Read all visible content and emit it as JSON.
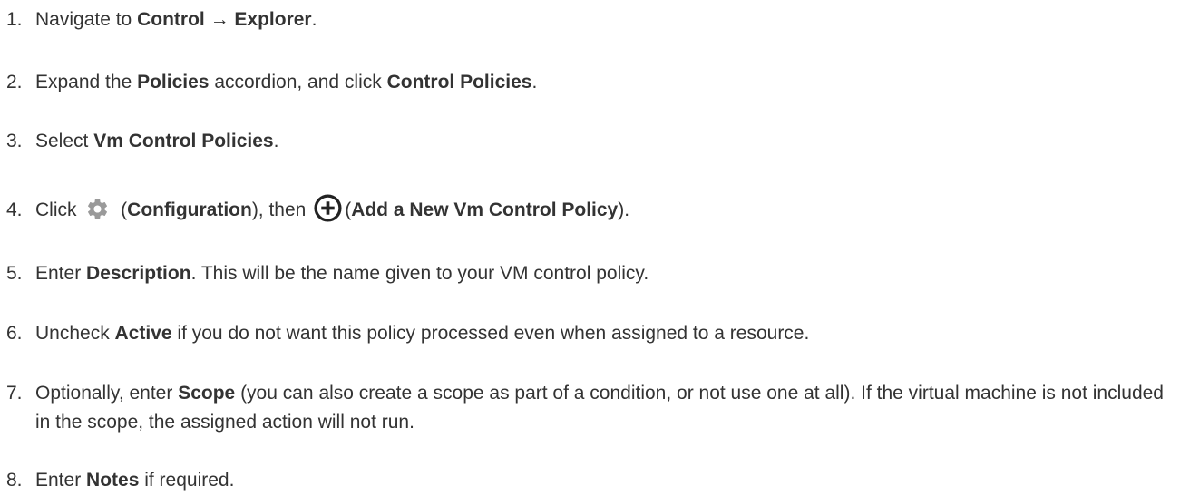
{
  "steps": [
    {
      "num": "1.",
      "t0": "Navigate to ",
      "b0": "Control",
      "t1": " → ",
      "b1": "Explorer",
      "t2": "."
    },
    {
      "num": "2.",
      "t0": "Expand the ",
      "b0": "Policies",
      "t1": " accordion, and click ",
      "b1": "Control Policies",
      "t2": "."
    },
    {
      "num": "3.",
      "t0": "Select ",
      "b0": "Vm Control Policies",
      "t1": "."
    },
    {
      "num": "4.",
      "t0": "Click ",
      "t1": " (",
      "b0": "Configuration",
      "t2": "), then ",
      "t3": "(",
      "b1": "Add a New Vm Control Policy",
      "t4": ").",
      "icon1": "gear-icon",
      "icon2": "plus-circle-icon"
    },
    {
      "num": "5.",
      "t0": "Enter ",
      "b0": "Description",
      "t1": ". This will be the name given to your VM control policy."
    },
    {
      "num": "6.",
      "t0": "Uncheck ",
      "b0": "Active",
      "t1": " if you do not want this policy processed even when assigned to a resource."
    },
    {
      "num": "7.",
      "t0": "Optionally, enter ",
      "b0": "Scope",
      "t1": " (you can also create a scope as part of a condition, or not use one at all). If the virtual machine is not included in the scope, the assigned action will not run."
    },
    {
      "num": "8.",
      "t0": "Enter ",
      "b0": "Notes",
      "t1": " if required."
    }
  ],
  "colors": {
    "text": "#333333",
    "gear_icon": "#9a9a9a",
    "plus_icon": "#222222"
  }
}
